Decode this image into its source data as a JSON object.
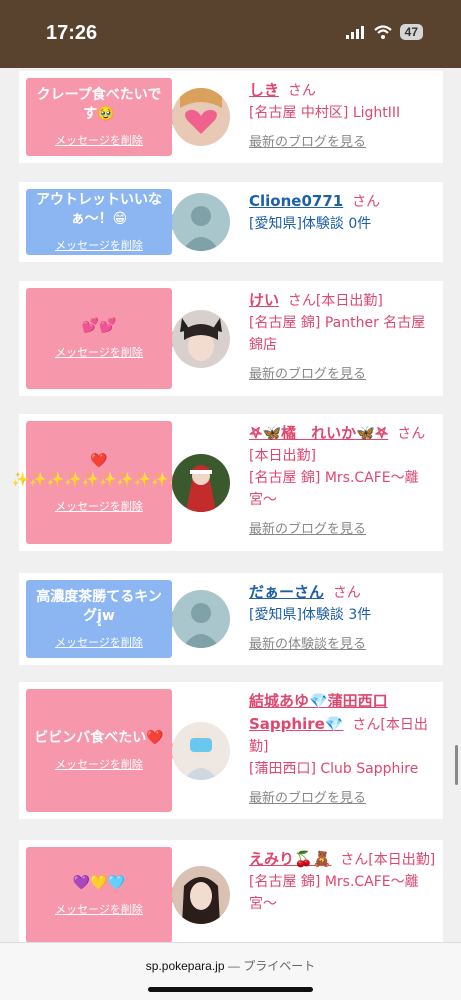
{
  "status": {
    "time": "17:26",
    "battery": "47"
  },
  "cards": [
    {
      "bubble_color": "pink",
      "message": "クレープ食べたいです🥹",
      "delete": "メッセージを削除",
      "avatar": "heart-face",
      "name": "しき",
      "name_color": "pink",
      "san": "さん",
      "detail": "[名古屋 中村区] LightIII",
      "link": "最新のブログを見る"
    },
    {
      "bubble_color": "blue",
      "message": "アウトレットいいなぁ〜！😁",
      "delete": "メッセージを削除",
      "avatar": "no-photo",
      "name": "Clione0771",
      "name_color": "blue",
      "san": "さん",
      "detail": "[愛知県]体験談 0件",
      "link": ""
    },
    {
      "bubble_color": "pink",
      "message": "💕💕",
      "delete": "メッセージを削除",
      "avatar": "cat-ears",
      "name": "けい",
      "name_color": "pink",
      "san": "さん[本日出勤]",
      "detail": "[名古屋 錦] Panther 名古屋錦店",
      "link": "最新のブログを見る"
    },
    {
      "bubble_color": "pink",
      "message": "❤️✨✨✨✨✨✨✨✨✨✨",
      "delete": "メッセージを削除",
      "avatar": "santa",
      "name": "𖤐🦋橘　れいか🦋𖤐",
      "name_color": "pink",
      "san": "さん[本日出勤]",
      "detail": "[名古屋 錦] Mrs.CAFE〜離宮〜",
      "link": "最新のブログを見る"
    },
    {
      "bubble_color": "blue",
      "message": "高濃度茶勝てるキングj͓w",
      "delete": "メッセージを削除",
      "avatar": "no-photo",
      "name": "だぁーさん",
      "name_color": "blue",
      "san": "さん",
      "detail": "[愛知県]体験談 3件",
      "link": "最新の体験談を見る"
    },
    {
      "bubble_color": "pink",
      "message": "ビビンバ食べたい❤️",
      "delete": "メッセージを削除",
      "avatar": "blue-mask",
      "name": "結城あゆ💎蒲田西口Sapphire💎",
      "name_color": "pink",
      "san": "さん[本日出勤]",
      "detail": "[蒲田西口] Club Sapphire",
      "link": "最新のブログを見る"
    },
    {
      "bubble_color": "pink",
      "message": "💜💛🩵",
      "delete": "メッセージを削除",
      "avatar": "dark-hair",
      "name": "えみり🍒🧸",
      "name_color": "pink",
      "san": "さん[本日出勤]",
      "detail": "[名古屋 錦] Mrs.CAFE〜離宮〜",
      "link": ""
    }
  ],
  "browser": {
    "domain": "sp.pokepara.jp",
    "suffix": "— プライベート"
  }
}
